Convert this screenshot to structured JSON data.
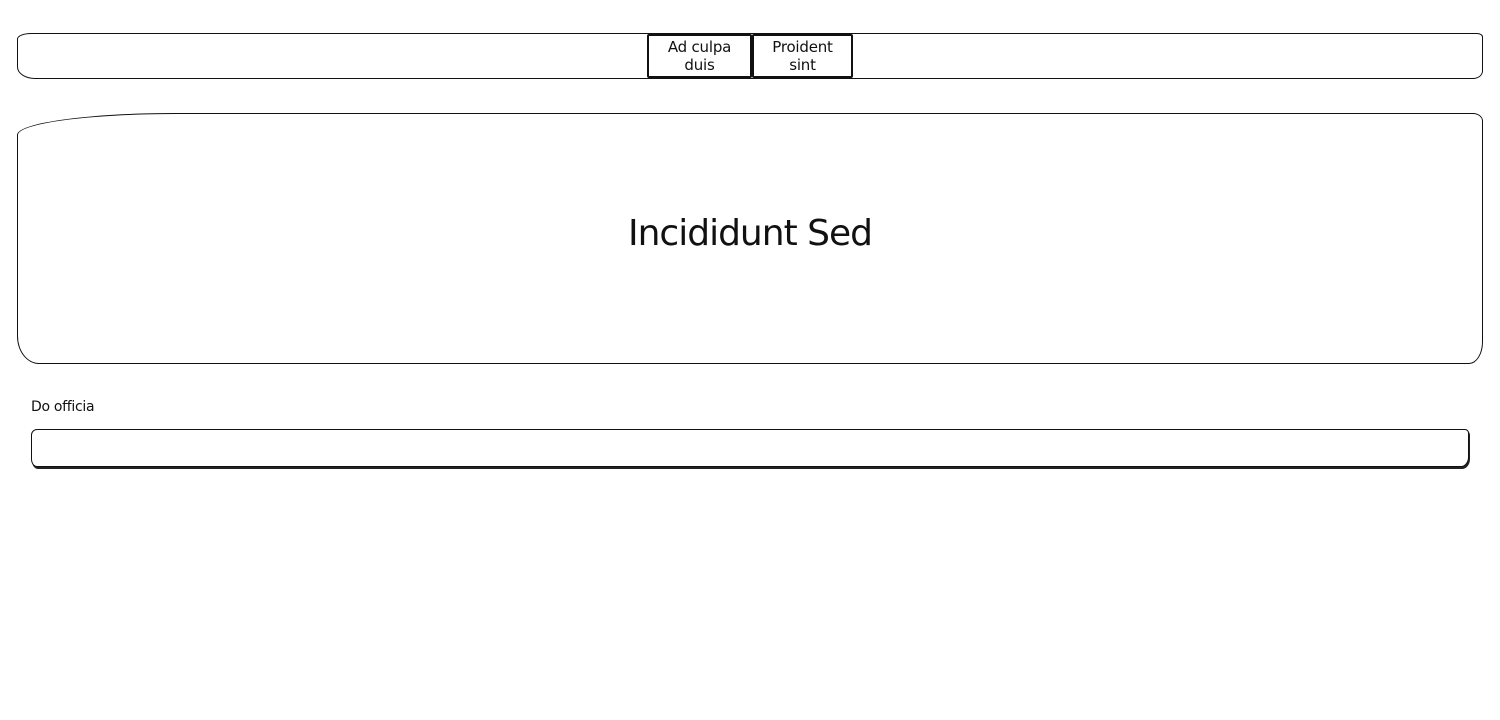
{
  "nav": {
    "buttons": [
      {
        "label": "Ad culpa duis"
      },
      {
        "label": "Proident sint"
      }
    ]
  },
  "hero": {
    "title": "Incididunt Sed"
  },
  "form": {
    "field_label": "Do officia",
    "field_value": "",
    "field_placeholder": ""
  }
}
